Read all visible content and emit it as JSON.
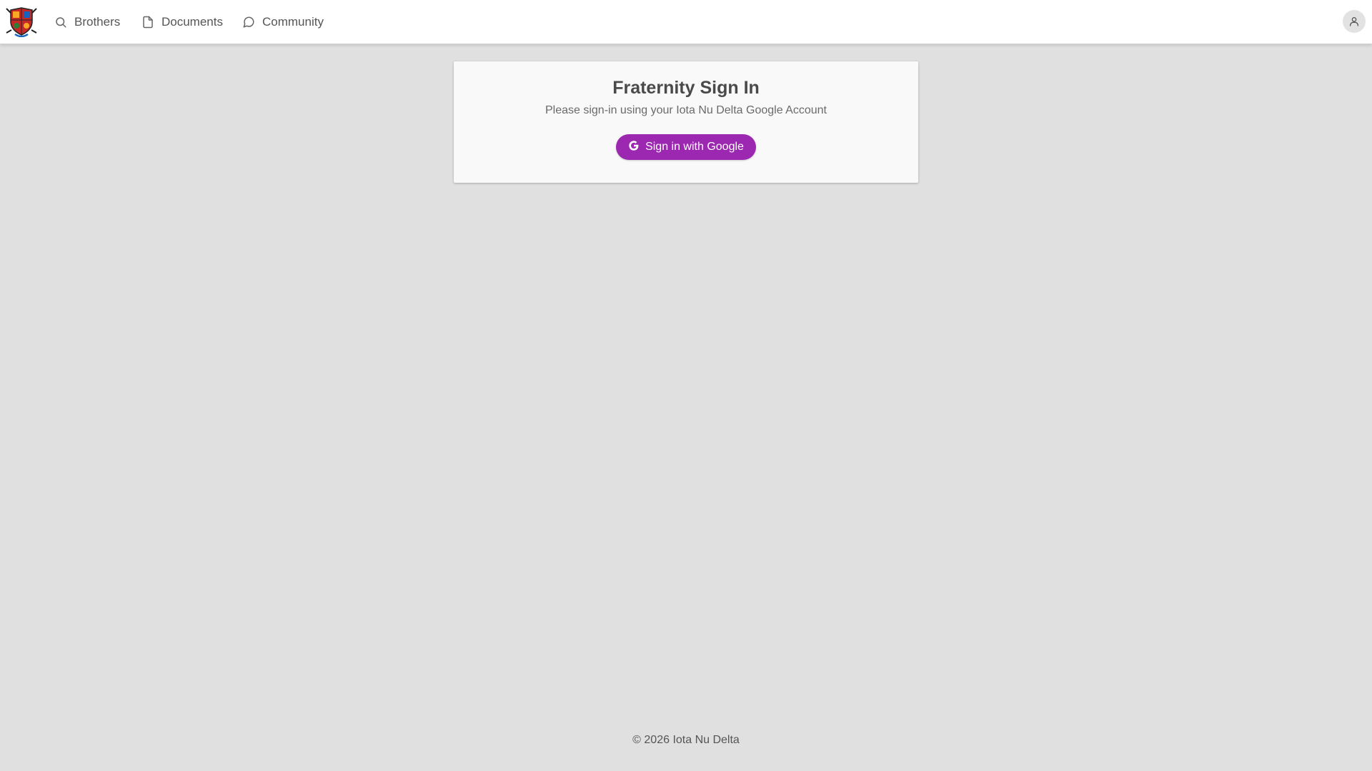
{
  "nav": {
    "logo_icon": "fraternity-crest-logo",
    "items": [
      {
        "label": "Brothers",
        "icon": "search-icon"
      },
      {
        "label": "Documents",
        "icon": "document-icon"
      },
      {
        "label": "Community",
        "icon": "chat-bubble-icon"
      }
    ],
    "account_icon": "user-icon"
  },
  "signin": {
    "title": "Fraternity Sign In",
    "subtitle": "Please sign-in using your Iota Nu Delta Google Account",
    "button_label": "Sign in with Google",
    "button_icon": "google-g-icon",
    "button_color": "#9c27b0"
  },
  "footer": {
    "text": "© 2026 Iota Nu Delta"
  },
  "colors": {
    "background": "#e0e0e0",
    "navbar": "#ffffff",
    "card": "#f9f9f9",
    "accent": "#9c27b0"
  }
}
